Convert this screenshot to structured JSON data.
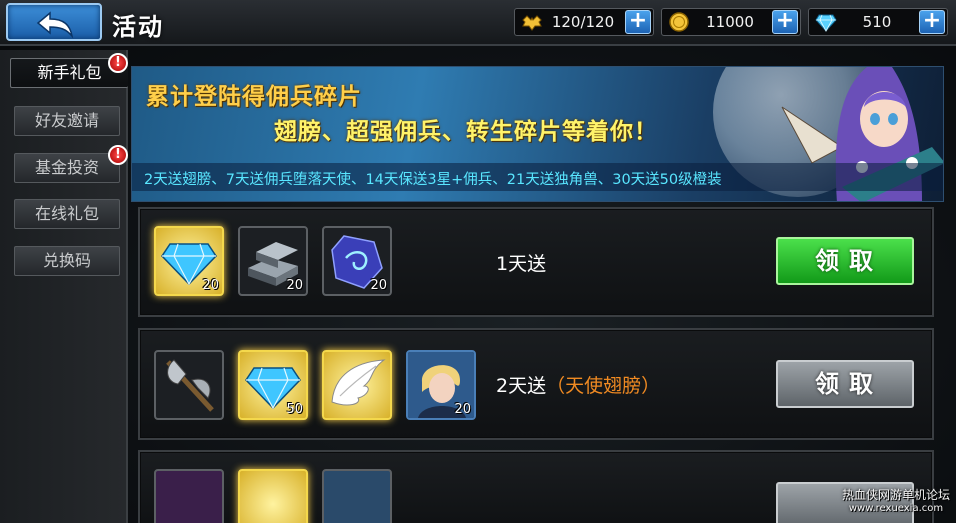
{
  "header": {
    "title": "活动",
    "resources": [
      {
        "icon": "stamina-icon",
        "value": "120/120"
      },
      {
        "icon": "gold-coin-icon",
        "value": "11000"
      },
      {
        "icon": "diamond-icon",
        "value": "510"
      }
    ],
    "plus": "+"
  },
  "sidebar": {
    "items": [
      {
        "label": "新手礼包",
        "badge": "!"
      },
      {
        "label": "好友邀请"
      },
      {
        "label": "基金投资",
        "badge": "!"
      },
      {
        "label": "在线礼包"
      },
      {
        "label": "兑换码"
      }
    ]
  },
  "banner": {
    "title": "累计登陆得佣兵碎片",
    "subtitle": "翅膀、超强佣兵、转生碎片等着你！",
    "note": "2天送翅膀、7天送佣兵堕落天使、14天保送3星+佣兵、21天送独角兽、30天送50级橙装"
  },
  "rewards": [
    {
      "label": "1天送",
      "highlight": "",
      "button": "领取",
      "items": [
        {
          "icon": "diamond-icon",
          "count": "20"
        },
        {
          "icon": "iron-ingot-icon",
          "count": "20"
        },
        {
          "icon": "rune-stone-icon",
          "count": "20"
        }
      ]
    },
    {
      "label": "2天送",
      "highlight": "（天使翅膀）",
      "button": "领取",
      "items": [
        {
          "icon": "battle-axe-icon",
          "count": ""
        },
        {
          "icon": "diamond-icon",
          "count": "50"
        },
        {
          "icon": "angel-wings-icon",
          "count": ""
        },
        {
          "icon": "hero-portrait-icon",
          "count": "20"
        }
      ]
    }
  ],
  "watermark": {
    "line1": "热血侠网游单机论坛",
    "line2": "www.rexuexia.com"
  },
  "colors": {
    "accent_blue": "#2f7cb2",
    "claim_green": "#2cc030",
    "highlight_orange": "#f08a22",
    "banner_title": "#ffcf4a"
  }
}
